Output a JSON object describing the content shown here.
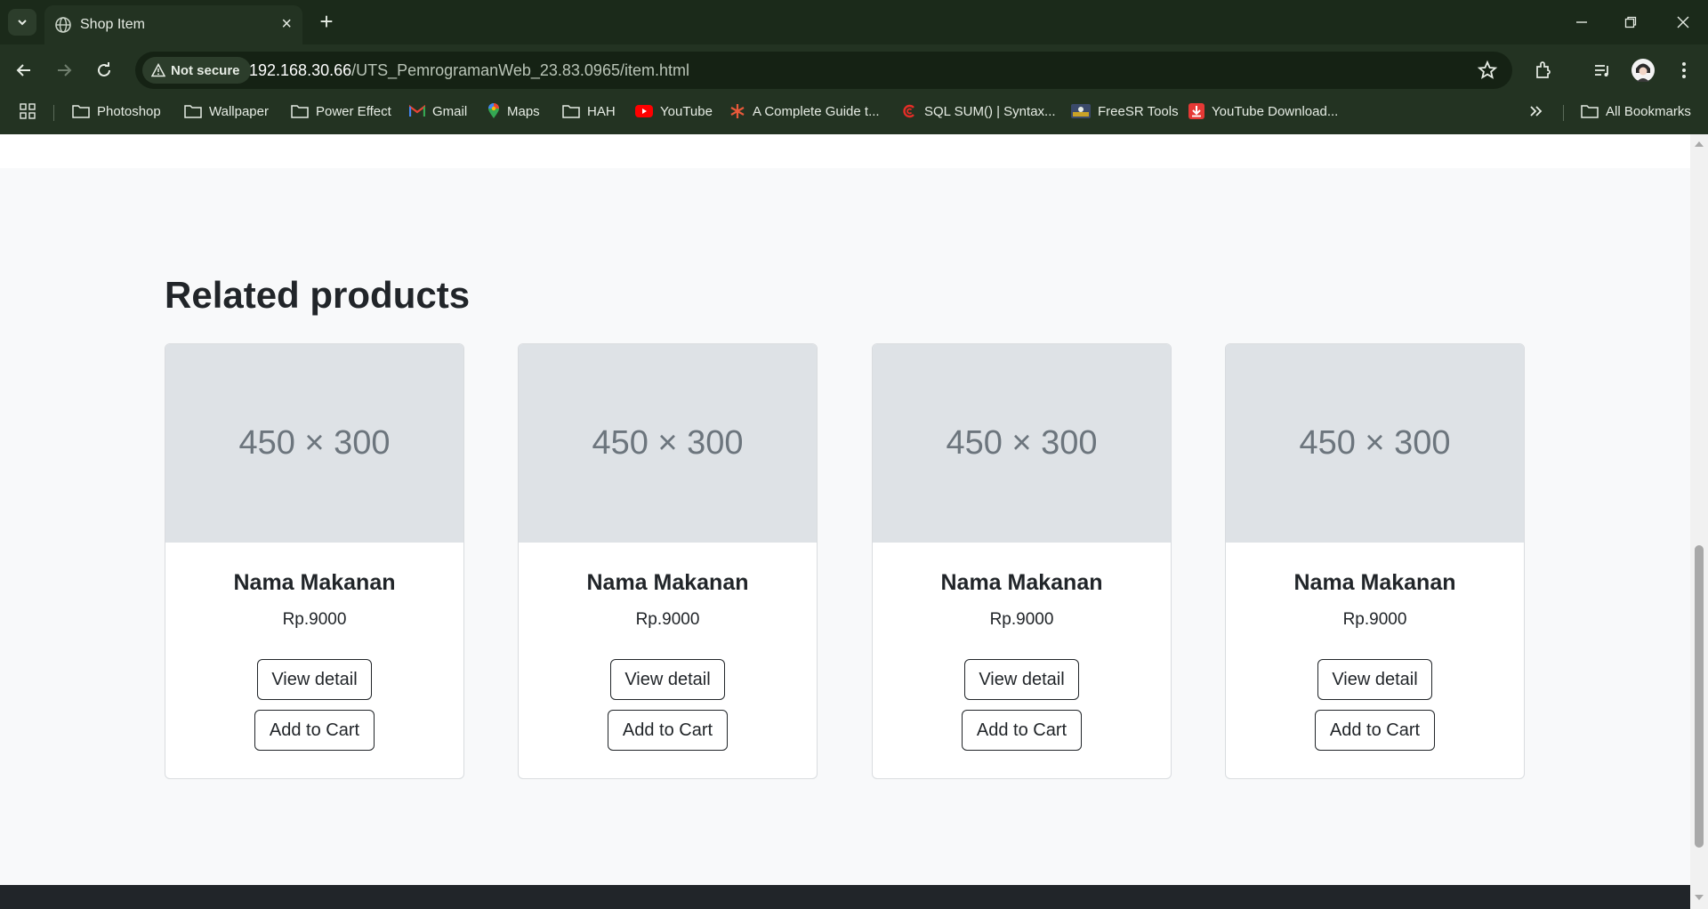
{
  "browser": {
    "tab_title": "Shop Item",
    "security_label": "Not secure",
    "url_host": "192.168.30.66",
    "url_path": "/UTS_PemrogramanWeb_23.83.0965/item.html",
    "bookmarks": [
      {
        "label": "Photoshop",
        "icon": "folder-icon"
      },
      {
        "label": "Wallpaper",
        "icon": "folder-icon"
      },
      {
        "label": "Power Effect",
        "icon": "folder-icon"
      },
      {
        "label": "Gmail",
        "icon": "gmail-icon"
      },
      {
        "label": "Maps",
        "icon": "maps-icon"
      },
      {
        "label": "HAH",
        "icon": "folder-icon"
      },
      {
        "label": "YouTube",
        "icon": "youtube-icon"
      },
      {
        "label": "A Complete Guide t...",
        "icon": "asterisk-icon"
      },
      {
        "label": "SQL SUM() | Syntax...",
        "icon": "sql-icon"
      },
      {
        "label": "FreeSR Tools",
        "icon": "freesr-icon"
      },
      {
        "label": "YouTube Download...",
        "icon": "download-icon"
      }
    ],
    "all_bookmarks": "All Bookmarks"
  },
  "page": {
    "section_title": "Related products",
    "products": [
      {
        "image_placeholder": "450 × 300",
        "name": "Nama Makanan",
        "price": "Rp.9000",
        "view_label": "View detail",
        "cart_label": "Add to Cart"
      },
      {
        "image_placeholder": "450 × 300",
        "name": "Nama Makanan",
        "price": "Rp.9000",
        "view_label": "View detail",
        "cart_label": "Add to Cart"
      },
      {
        "image_placeholder": "450 × 300",
        "name": "Nama Makanan",
        "price": "Rp.9000",
        "view_label": "View detail",
        "cart_label": "Add to Cart"
      },
      {
        "image_placeholder": "450 × 300",
        "name": "Nama Makanan",
        "price": "Rp.9000",
        "view_label": "View detail",
        "cart_label": "Add to Cart"
      }
    ]
  },
  "colors": {
    "browser_frame": "#233322",
    "tab_strip": "#1b2a1a",
    "page_background": "#f8f9fa",
    "image_placeholder": "#dee2e6",
    "footer": "#212529"
  }
}
